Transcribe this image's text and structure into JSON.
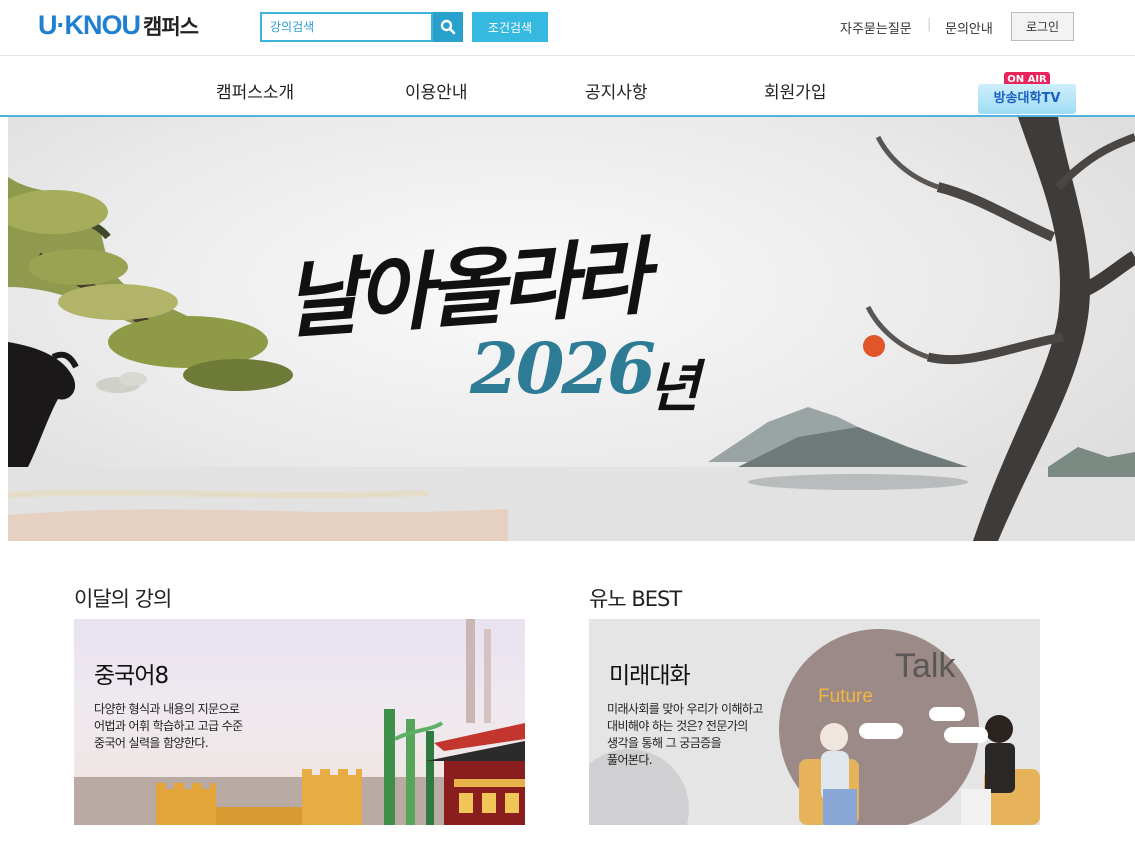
{
  "header": {
    "logo_main": "U·KNOU",
    "logo_sub": "캠퍼스",
    "search_placeholder": "강의검색",
    "filter_button": "조건검색",
    "faq_link": "자주묻는질문",
    "separator": "|",
    "contact_link": "문의안내",
    "login_button": "로그인"
  },
  "nav": {
    "items": [
      "캠퍼스소개",
      "이용안내",
      "공지사항",
      "회원가입"
    ],
    "onair_badge": "ON AIR",
    "tv_label": "방송대학TV"
  },
  "hero": {
    "title": "날아올라라",
    "year": "2026",
    "year_suffix": "년"
  },
  "sections": [
    {
      "heading": "이달의 강의",
      "card_title": "중국어8",
      "card_desc": [
        "다양한 형식과 내용의 지문으로",
        "어법과 어휘 학습하고 고급 수준",
        "중국어 실력을 함양한다."
      ]
    },
    {
      "heading": "유노 BEST",
      "card_title": "미래대화",
      "card_desc": [
        "미래사회를 맞아 우리가 이해하고",
        "대비해야 하는 것은? 전문가의",
        "생각을 통해 그 궁금증을",
        "풀어본다."
      ],
      "illustration_text": [
        "Talk",
        "Future"
      ]
    }
  ],
  "colors": {
    "brand_blue": "#1f7fd1",
    "search_border": "#3cb4d9",
    "nav_line": "#4fb3df",
    "onair_red": "#e8245c"
  }
}
